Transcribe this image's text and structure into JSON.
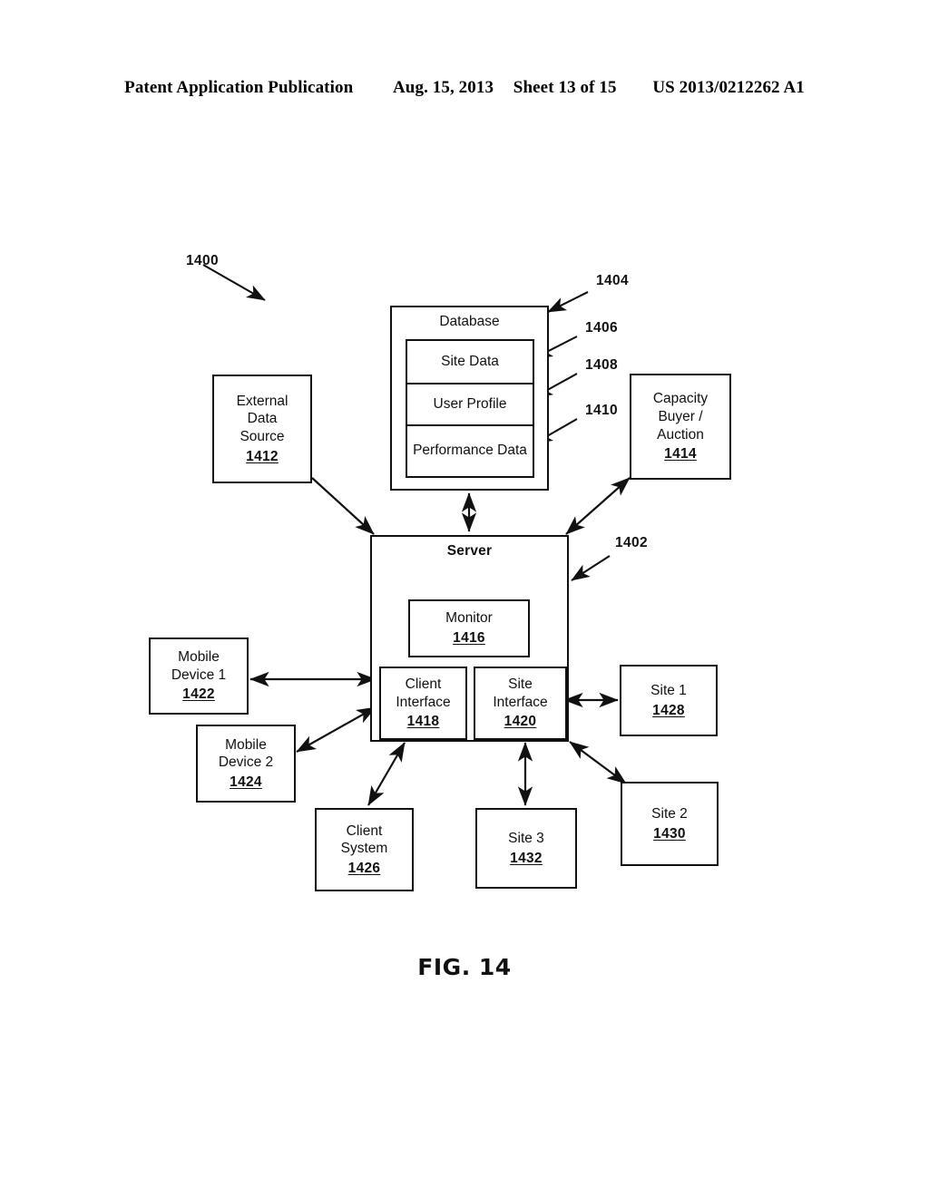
{
  "header": {
    "publication": "Patent Application Publication",
    "date": "Aug. 15, 2013",
    "sheet": "Sheet 13 of 15",
    "patent_number": "US 2013/0212262 A1"
  },
  "figure": {
    "caption": "FIG. 14"
  },
  "nodes": {
    "system": {
      "ref": "1400"
    },
    "database": {
      "title": "Database",
      "ref": "1404",
      "cells": [
        {
          "label": "Site Data",
          "ref": "1406"
        },
        {
          "label": "User Profile",
          "ref": "1408"
        },
        {
          "label": "Performance Data",
          "label_line1": "Performance",
          "label_line2": "Data",
          "ref": "1410"
        }
      ]
    },
    "external_data_source": {
      "line1": "External",
      "line2": "Data",
      "line3": "Source",
      "ref": "1412"
    },
    "capacity_buyer": {
      "line1": "Capacity",
      "line2": "Buyer /",
      "line3": "Auction",
      "ref": "1414"
    },
    "server": {
      "title": "Server",
      "ref": "1402"
    },
    "monitor": {
      "line1": "Monitor",
      "ref": "1416"
    },
    "client_interface": {
      "line1": "Client",
      "line2": "Interface",
      "ref": "1418"
    },
    "site_interface": {
      "line1": "Site",
      "line2": "Interface",
      "ref": "1420"
    },
    "mobile_device_1": {
      "line1": "Mobile",
      "line2": "Device 1",
      "ref": "1422"
    },
    "mobile_device_2": {
      "line1": "Mobile",
      "line2": "Device 2",
      "ref": "1424"
    },
    "client_system": {
      "line1": "Client",
      "line2": "System",
      "ref": "1426"
    },
    "site_1": {
      "line1": "Site 1",
      "ref": "1428"
    },
    "site_2": {
      "line1": "Site 2",
      "ref": "1430"
    },
    "site_3": {
      "line1": "Site 3",
      "ref": "1432"
    }
  },
  "colors": {
    "ink": "#111111",
    "paper": "#ffffff"
  }
}
